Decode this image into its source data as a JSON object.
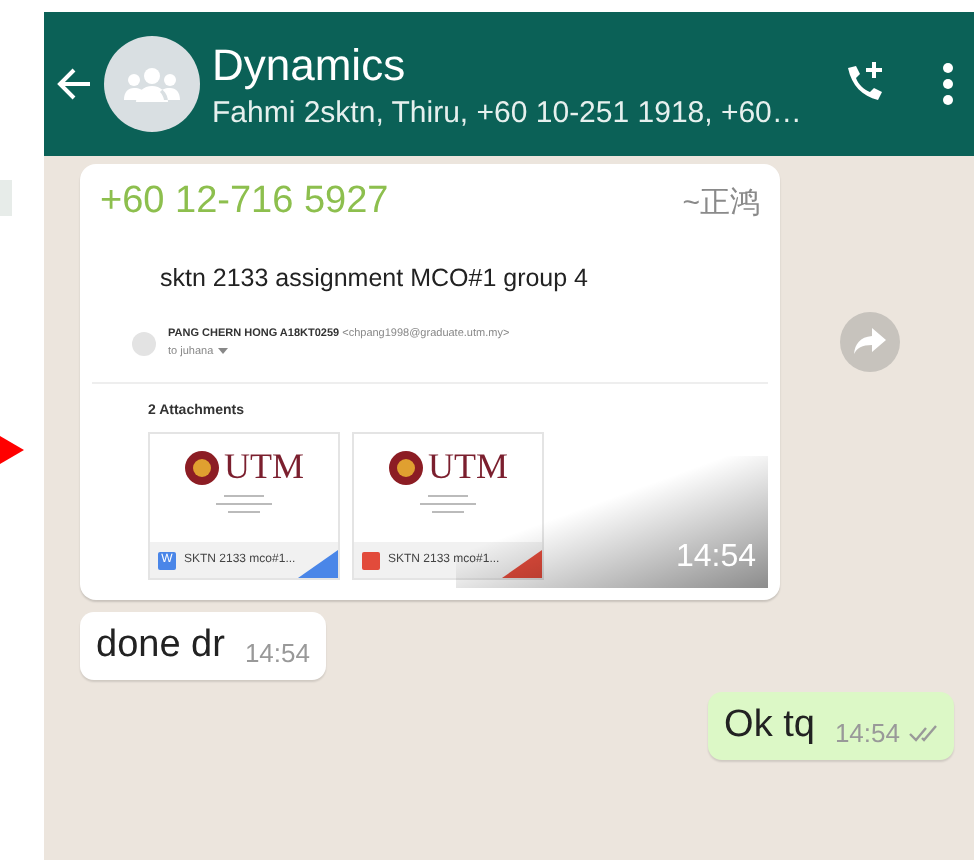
{
  "header": {
    "title": "Dynamics",
    "subtitle": "Fahmi 2sktn, Thiru, +60 10-251 1918, +60…"
  },
  "messages": [
    {
      "kind": "email",
      "sender": "+60 12-716 5927",
      "sender_name": "~正鸿",
      "time": "14:54",
      "email": {
        "subject": "sktn 2133 assignment MCO#1 group 4",
        "from_name": "PANG CHERN HONG A18KT0259",
        "from_address": "<chpang1998@graduate.utm.my>",
        "to": "to juhana",
        "attachments_heading": "2 Attachments",
        "attachments": [
          {
            "kind": "word",
            "icon_label": "W",
            "logo_text": "UTM",
            "name": "SKTN 2133 mco#1..."
          },
          {
            "kind": "pdf",
            "logo_text": "UTM",
            "name": "SKTN 2133 mco#1..."
          }
        ]
      }
    },
    {
      "kind": "text",
      "outgoing": false,
      "text": "done dr",
      "time": "14:54"
    },
    {
      "kind": "text",
      "outgoing": true,
      "text": "Ok tq",
      "time": "14:54",
      "read": false
    }
  ]
}
